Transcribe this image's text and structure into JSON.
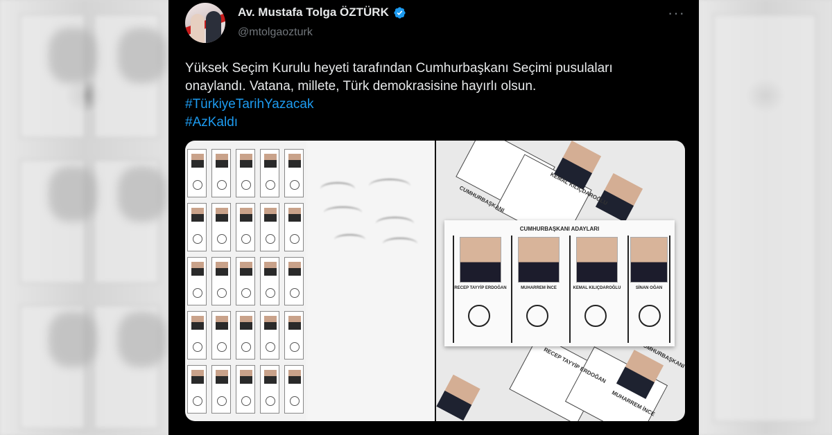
{
  "tweet": {
    "display_name": "Av. Mustafa Tolga ÖZTÜRK",
    "handle": "@mtolgaozturk",
    "more_glyph": "···",
    "text_lines": [
      "Yüksek Seçim Kurulu heyeti tarafından Cumhurbaşkanı Seçimi pusulaları",
      "onaylandı. Vatana, millete, Türk demokrasisine hayırlı olsun."
    ],
    "hashtags": [
      "#TürkiyeTarihYazacak",
      "#AzKaldı"
    ]
  },
  "ballot": {
    "title": "CUMHURBAŞKANI ADAYLARI",
    "candidates": [
      {
        "name": "RECEP TAYYİP ERDOĞAN"
      },
      {
        "name": "MUHARREM İNCE"
      },
      {
        "name": "KEMAL KILIÇDAROĞLU"
      },
      {
        "name": "SİNAN OĞAN"
      }
    ],
    "tilted_labels": [
      "CUMHURBAŞKANI",
      "KEMAL KILIÇDAROĞLU",
      "RECEP TAYYİP ERDOĞAN",
      "MUHARREM İNCE",
      "CUMHURBAŞKANI",
      "MUHARREM İNCE"
    ]
  },
  "colors": {
    "accent": "#1d9bf0",
    "background": "#000000",
    "text": "#e7e9ea",
    "muted": "#71767b"
  },
  "icons": {
    "verified": "verified-badge-icon",
    "more": "more-options-icon"
  }
}
